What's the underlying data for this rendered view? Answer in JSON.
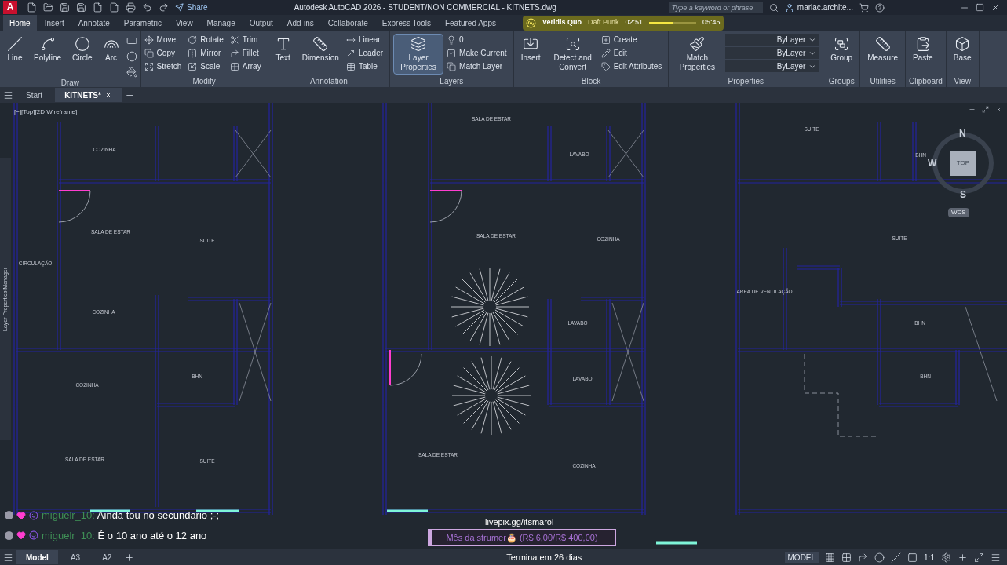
{
  "app_button": "A",
  "quick_access": {
    "share": "Share"
  },
  "title": "Autodesk AutoCAD 2026 - STUDENT/NON COMMERCIAL - KITNETS.dwg",
  "search": {
    "placeholder": "Type a keyword or phrase"
  },
  "user": "mariac.archite...",
  "now_playing": {
    "song": "Veridis Quo",
    "artist": "Daft Punk",
    "elapsed": "02:51",
    "total": "05:45",
    "level": 0.5
  },
  "ribbon_tabs": [
    {
      "label": "Home",
      "selected": true
    },
    {
      "label": "Insert",
      "selected": false
    },
    {
      "label": "Annotate",
      "selected": false
    },
    {
      "label": "Parametric",
      "selected": false
    },
    {
      "label": "View",
      "selected": false
    },
    {
      "label": "Manage",
      "selected": false
    },
    {
      "label": "Output",
      "selected": false
    },
    {
      "label": "Add-ins",
      "selected": false
    },
    {
      "label": "Collaborate",
      "selected": false
    },
    {
      "label": "Express Tools",
      "selected": false
    },
    {
      "label": "Featured Apps",
      "selected": false
    }
  ],
  "panels": [
    {
      "title": "Draw",
      "large": [
        {
          "label": "Line",
          "active": false
        },
        {
          "label": "Polyline",
          "active": false
        },
        {
          "label": "Circle",
          "active": false
        },
        {
          "label": "Arc",
          "active": false
        }
      ]
    },
    {
      "title": "Modify",
      "small": [
        "Move",
        "Copy",
        "Stretch",
        "Rotate",
        "Mirror",
        "Scale",
        "Trim",
        "Fillet",
        "Array"
      ]
    },
    {
      "title": "Annotation",
      "large": [
        {
          "label": "Text",
          "active": false
        },
        {
          "label": "Dimension",
          "active": false
        }
      ],
      "small": [
        "Linear",
        "Leader",
        "Table"
      ]
    },
    {
      "title": "Layers",
      "large": [
        {
          "label": "Layer Properties",
          "active": true
        }
      ],
      "small": [
        "0",
        "Make Current",
        "Match Layer"
      ]
    },
    {
      "title": "Block",
      "large": [
        {
          "label": "Insert",
          "active": false
        },
        {
          "label": "Detect and Convert",
          "active": false
        }
      ],
      "small": [
        "Create",
        "Edit",
        "Edit Attributes"
      ]
    },
    {
      "title": "Properties",
      "large": [
        {
          "label": "Match Properties",
          "active": false
        }
      ],
      "small": [
        "ByLayer",
        "ByLayer",
        "ByLayer"
      ]
    },
    {
      "title": "Groups",
      "large": [
        {
          "label": "Group",
          "active": false
        }
      ]
    },
    {
      "title": "Utilities",
      "large": [
        {
          "label": "Measure",
          "active": false
        }
      ]
    },
    {
      "title": "Clipboard",
      "large": [
        {
          "label": "Paste",
          "active": false
        }
      ]
    },
    {
      "title": "View",
      "large": [
        {
          "label": "Base",
          "active": false
        }
      ]
    }
  ],
  "file_tabs": [
    {
      "label": "Start",
      "selected": false,
      "closable": false
    },
    {
      "label": "KITNETS*",
      "selected": true,
      "closable": true
    }
  ],
  "viewport_label": "[−][Top][2D Wireframe]",
  "palette_label": "Layer Properties Manager",
  "viewcube": {
    "north": "N",
    "west": "W",
    "face": "TOP",
    "south": "S",
    "ucs": "WCS"
  },
  "rooms": [
    "COZINHA",
    "SALA DE ESTAR",
    "SUITE",
    "CIRCULAÇÃO",
    "COZINHA",
    "BHN",
    "COZINHA",
    "SALA DE ESTAR",
    "SUITE",
    "SALA DE ESTAR",
    "LAVABO",
    "SALA DE ESTAR",
    "COZINHA",
    "LAVABO",
    "LAVABO",
    "SALA DE ESTAR",
    "COZINHA",
    "SUITE",
    "BHN",
    "SUITE",
    "AREA DE VENTILAÇÃO",
    "BHN",
    "BHN"
  ],
  "chat": [
    {
      "user": "miguelr_10:",
      "text": "Ainda tou no secundario ;-;"
    },
    {
      "user": "miguelr_10:",
      "text": "É o 10 ano até o 12 ano"
    }
  ],
  "donation": {
    "link": "livepix.gg/itsmarol",
    "goal": "Mês da strumer🎂 (R$ 6,00/R$ 400,00)",
    "level": 0.015,
    "ends": "Termina em 26 dias"
  },
  "layout_tabs": [
    {
      "label": "Model",
      "selected": true
    },
    {
      "label": "A3",
      "selected": false
    },
    {
      "label": "A2",
      "selected": false
    }
  ],
  "status": {
    "space": "MODEL",
    "scale": "1:1"
  }
}
